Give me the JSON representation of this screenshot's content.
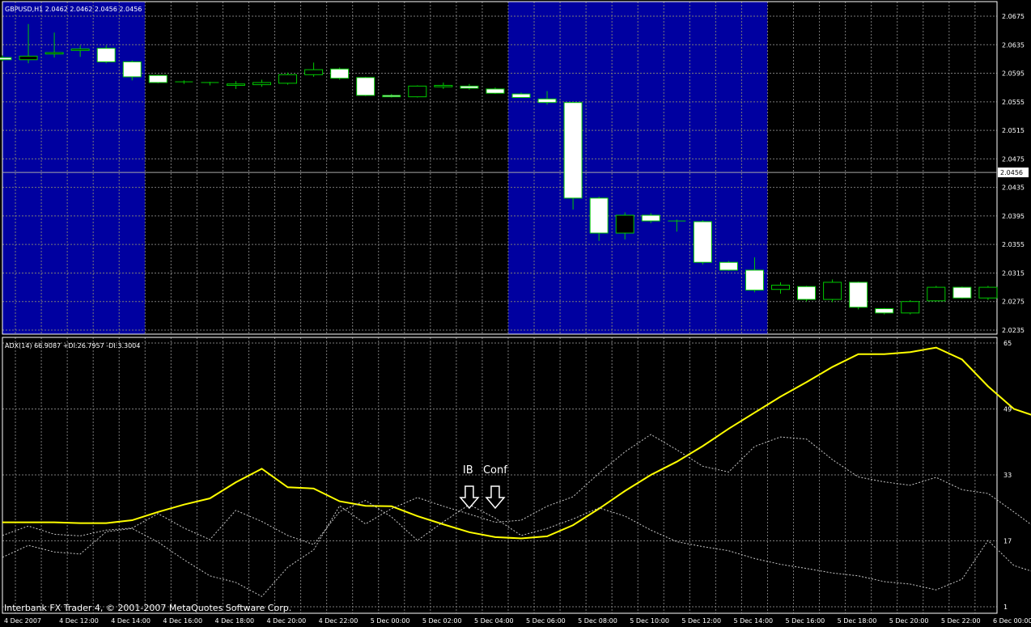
{
  "price_header": "GBPUSD,H1  2.0462 2.0462 2.0456 2.0456",
  "indicator_header": "ADX(14) 66.9087 +DI:26.7957 -DI:3.3004",
  "footer": "Interbank FX Trader 4, © 2001-2007 MetaQuotes Software Corp.",
  "current_price": "2.0456",
  "colors": {
    "background": "#000000",
    "session_fill": "#0000a0",
    "grid": "#7a7a7a",
    "bull_candle": "#00c800",
    "bear_fill": "#ffffff",
    "adx_line": "#ffff00",
    "di_line": "#c8c8c8",
    "text": "#ffffff"
  },
  "annotations": [
    {
      "text": "IB",
      "category_index": 18
    },
    {
      "text": "Conf",
      "category_index": 19
    }
  ],
  "chart_data": [
    {
      "type": "candlestick",
      "symbol": "GBPUSD",
      "timeframe": "H1",
      "ylim": [
        2.0235,
        2.0675
      ],
      "y_ticks": [
        "2.0675",
        "2.0635",
        "2.0595",
        "2.0555",
        "2.0515",
        "2.0475",
        "2.0435",
        "2.0395",
        "2.0355",
        "2.0315",
        "2.0275",
        "2.0235"
      ],
      "x_ticks": [
        "4 Dec 2007",
        "4 Dec 12:00",
        "4 Dec 14:00",
        "4 Dec 16:00",
        "4 Dec 18:00",
        "4 Dec 20:00",
        "4 Dec 22:00",
        "5 Dec 00:00",
        "5 Dec 02:00",
        "5 Dec 04:00",
        "5 Dec 06:00",
        "5 Dec 08:00",
        "5 Dec 10:00",
        "5 Dec 12:00",
        "5 Dec 14:00",
        "5 Dec 16:00",
        "5 Dec 18:00",
        "5 Dec 20:00",
        "5 Dec 22:00",
        "6 Dec 00:00"
      ],
      "session_bands": [
        [
          -1,
          5.5
        ],
        [
          19.5,
          29.5
        ]
      ],
      "candles": [
        {
          "o": 2.0617,
          "h": 2.062,
          "l": 2.0612,
          "c": 2.0614
        },
        {
          "o": 2.0614,
          "h": 2.0664,
          "l": 2.0609,
          "c": 2.0619
        },
        {
          "o": 2.0622,
          "h": 2.0652,
          "l": 2.0617,
          "c": 2.0624
        },
        {
          "o": 2.0627,
          "h": 2.0634,
          "l": 2.0618,
          "c": 2.0629
        },
        {
          "o": 2.063,
          "h": 2.0634,
          "l": 2.0609,
          "c": 2.0611
        },
        {
          "o": 2.0611,
          "h": 2.0613,
          "l": 2.0585,
          "c": 2.059
        },
        {
          "o": 2.0592,
          "h": 2.0593,
          "l": 2.0581,
          "c": 2.0582
        },
        {
          "o": 2.0582,
          "h": 2.0585,
          "l": 2.058,
          "c": 2.0583
        },
        {
          "o": 2.0581,
          "h": 2.0583,
          "l": 2.0578,
          "c": 2.0582
        },
        {
          "o": 2.0578,
          "h": 2.0584,
          "l": 2.0573,
          "c": 2.058
        },
        {
          "o": 2.0579,
          "h": 2.0586,
          "l": 2.0576,
          "c": 2.0582
        },
        {
          "o": 2.0581,
          "h": 2.0596,
          "l": 2.0579,
          "c": 2.0593
        },
        {
          "o": 2.0593,
          "h": 2.061,
          "l": 2.059,
          "c": 2.06
        },
        {
          "o": 2.0601,
          "h": 2.0603,
          "l": 2.0586,
          "c": 2.0588
        },
        {
          "o": 2.0589,
          "h": 2.059,
          "l": 2.0563,
          "c": 2.0564
        },
        {
          "o": 2.0564,
          "h": 2.0566,
          "l": 2.0561,
          "c": 2.0562
        },
        {
          "o": 2.0562,
          "h": 2.0578,
          "l": 2.0561,
          "c": 2.0577
        },
        {
          "o": 2.0576,
          "h": 2.0582,
          "l": 2.0573,
          "c": 2.0578
        },
        {
          "o": 2.0577,
          "h": 2.058,
          "l": 2.0572,
          "c": 2.0574
        },
        {
          "o": 2.0573,
          "h": 2.0575,
          "l": 2.0566,
          "c": 2.0567
        },
        {
          "o": 2.0566,
          "h": 2.0568,
          "l": 2.0561,
          "c": 2.0561
        },
        {
          "o": 2.0559,
          "h": 2.057,
          "l": 2.0551,
          "c": 2.0554
        },
        {
          "o": 2.0554,
          "h": 2.0555,
          "l": 2.0404,
          "c": 2.042
        },
        {
          "o": 2.042,
          "h": 2.0422,
          "l": 2.036,
          "c": 2.0371
        },
        {
          "o": 2.0371,
          "h": 2.04,
          "l": 2.0362,
          "c": 2.0396
        },
        {
          "o": 2.0396,
          "h": 2.0399,
          "l": 2.0385,
          "c": 2.0388
        },
        {
          "o": 2.0388,
          "h": 2.039,
          "l": 2.0373,
          "c": 2.0387
        },
        {
          "o": 2.0387,
          "h": 2.0389,
          "l": 2.0327,
          "c": 2.033
        },
        {
          "o": 2.033,
          "h": 2.0332,
          "l": 2.0318,
          "c": 2.0319
        },
        {
          "o": 2.0319,
          "h": 2.0337,
          "l": 2.0288,
          "c": 2.0291
        },
        {
          "o": 2.0292,
          "h": 2.0302,
          "l": 2.0286,
          "c": 2.0298
        },
        {
          "o": 2.0296,
          "h": 2.0297,
          "l": 2.0275,
          "c": 2.0278
        },
        {
          "o": 2.0278,
          "h": 2.0306,
          "l": 2.0274,
          "c": 2.0302
        },
        {
          "o": 2.0302,
          "h": 2.0303,
          "l": 2.0264,
          "c": 2.0267
        },
        {
          "o": 2.0265,
          "h": 2.0266,
          "l": 2.0257,
          "c": 2.0259
        },
        {
          "o": 2.0259,
          "h": 2.0277,
          "l": 2.0257,
          "c": 2.0275
        },
        {
          "o": 2.0276,
          "h": 2.0297,
          "l": 2.0275,
          "c": 2.0295
        },
        {
          "o": 2.0295,
          "h": 2.0296,
          "l": 2.0279,
          "c": 2.028
        },
        {
          "o": 2.028,
          "h": 2.0297,
          "l": 2.0277,
          "c": 2.0295
        }
      ]
    },
    {
      "type": "line",
      "title": "ADX(14) 66.9087 +DI:26.7957 -DI:3.3004",
      "ylim": [
        1,
        65
      ],
      "y_ticks": [
        "65",
        "49",
        "33",
        "17",
        "1"
      ],
      "series": [
        {
          "name": "ADX(14)",
          "style": "solid",
          "values": [
            21.5,
            21.5,
            21.5,
            21.3,
            21.3,
            22.0,
            24.0,
            25.8,
            27.3,
            31.2,
            34.5,
            30.0,
            29.7,
            26.6,
            25.5,
            25.4,
            23.0,
            21.0,
            19.1,
            17.9,
            17.6,
            18.1,
            20.8,
            24.8,
            29.1,
            33.0,
            36.2,
            40.0,
            44.2,
            48.1,
            52.0,
            55.5,
            59.2,
            62.3,
            62.3,
            62.8,
            63.9,
            61.0,
            54.5,
            49.0,
            46.9
          ]
        },
        {
          "name": "+DI",
          "style": "dotted",
          "values": [
            18.3,
            20.6,
            18.6,
            18.2,
            19.6,
            20.1,
            23.6,
            20.1,
            17.3,
            24.4,
            21.7,
            18.3,
            16.1,
            24.1,
            26.8,
            22.8,
            17.1,
            21.6,
            25.8,
            22.5,
            18.3,
            20.0,
            22.3,
            25.0,
            23.0,
            19.6,
            16.8,
            15.6,
            14.6,
            12.7,
            11.3,
            10.3,
            9.2,
            8.5,
            7.1,
            6.5,
            5.1,
            7.7,
            17.1,
            11.0,
            9.0
          ]
        },
        {
          "name": "-DI",
          "style": "dotted",
          "values": [
            13.0,
            15.9,
            14.3,
            13.8,
            19.2,
            20.0,
            16.7,
            12.4,
            8.5,
            6.9,
            3.5,
            10.6,
            14.8,
            25.5,
            21.1,
            24.8,
            27.5,
            25.4,
            23.5,
            21.5,
            22.0,
            25.4,
            27.7,
            33.4,
            38.6,
            42.8,
            39.1,
            35.1,
            33.7,
            39.9,
            42.2,
            41.7,
            36.7,
            32.5,
            31.3,
            30.5,
            32.4,
            29.4,
            28.5,
            24.0,
            19.4
          ]
        }
      ]
    }
  ]
}
